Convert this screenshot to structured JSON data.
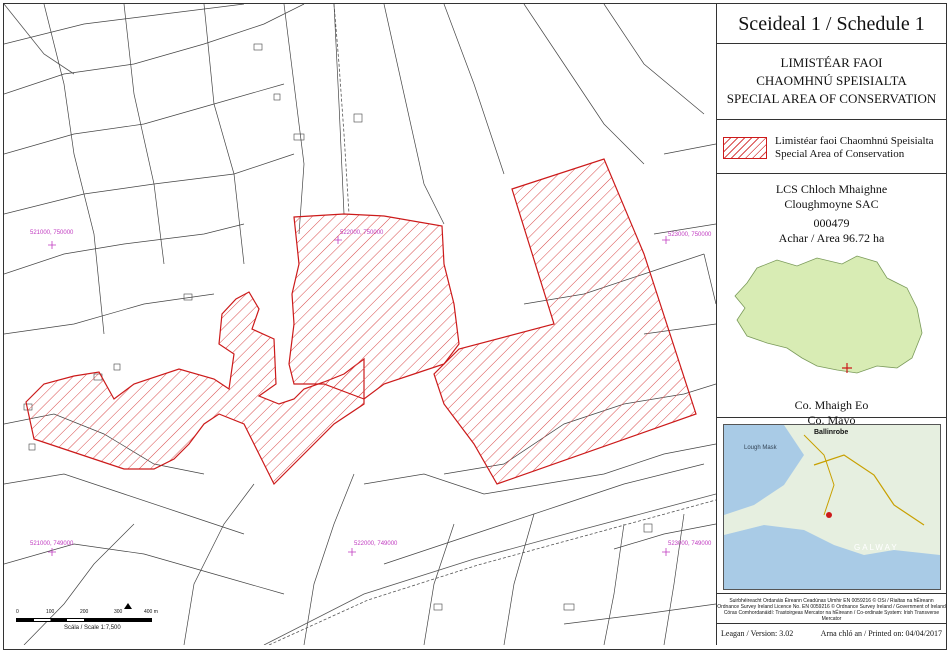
{
  "title": "Sceideal 1 / Schedule 1",
  "designation": {
    "line1": "LIMISTÉAR FAOI",
    "line2": "CHAOMHNÚ SPEISIALTA",
    "line3": "SPECIAL AREA OF CONSERVATION"
  },
  "legend": {
    "irish": "Limistéar faoi Chaomhnú Speisialta",
    "english": "Special Area of Conservation"
  },
  "site": {
    "name_irish": "LCS Chloch Mhaighne",
    "name_english": "Cloughmoyne SAC",
    "code": "000479",
    "area": "Achar / Area 96.72 ha",
    "county_irish": "Co. Mhaigh Eo",
    "county_english": "Co. Mayo"
  },
  "grid_labels": {
    "nw": "521000, 750000",
    "nc": "522000, 750000",
    "ne": "523000, 750000",
    "sw": "521000, 749000",
    "sc": "522000, 749000",
    "se": "523000, 749000"
  },
  "scale": {
    "ticks": [
      "0",
      "100",
      "200",
      "300",
      "400 m"
    ],
    "label": "Scála / Scale 1:7,500"
  },
  "inset_labels": {
    "town": "Ballinrobe",
    "lake": "Lough Mask",
    "galway": "GALWAY"
  },
  "credits": [
    "Suirbhéireacht Ordanáis Éireann Ceadúnas Uimhir EN 0059216 © OSi / Rialtas na hÉireann",
    "Ordnance Survey Ireland Licence No. EN 0059216 © Ordnance Survey Ireland / Government of Ireland",
    "Córas Comhordanáidí: Trastoirgeas Mercator na hÉireann / Co-ordinate System: Irish Transverse Mercator"
  ],
  "version": "Leagan / Version: 3.02",
  "printed": "Arna chló an / Printed on: 04/04/2017",
  "colors": {
    "sac_outline": "#cc1a1a",
    "hatch": "#d94a4a",
    "county_fill": "#d8ecb4",
    "grid_label": "#c03ac0"
  }
}
